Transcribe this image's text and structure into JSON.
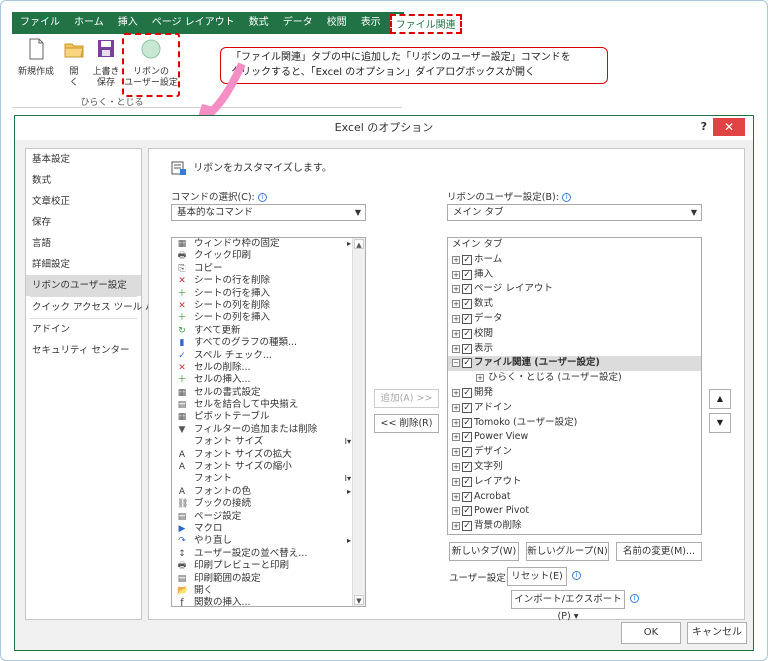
{
  "ribbon": {
    "tabs": [
      "ファイル",
      "ホーム",
      "挿入",
      "ページ レイアウト",
      "数式",
      "データ",
      "校閲",
      "表示"
    ],
    "active_tab": "ファイル関連",
    "buttons": [
      {
        "label": "新規作成"
      },
      {
        "label": "開\nく"
      },
      {
        "label": "上書き\n保存"
      },
      {
        "label": "リボンの\nユーザー設定"
      }
    ],
    "group_label": "ひらく・とじる"
  },
  "callout": {
    "line1": "「ファイル関連」タブの中に追加した「リボンのユーザー設定」コマンドを",
    "line2": "クリックすると、「Excel のオプション」ダイアログボックスが開く"
  },
  "dialog": {
    "title": "Excel のオプション",
    "help": "?",
    "close": "✕",
    "categories": [
      "基本設定",
      "数式",
      "文章校正",
      "保存",
      "言語",
      "詳細設定",
      "リボンのユーザー設定",
      "クイック アクセス ツール バー",
      "アドイン",
      "セキュリティ センター"
    ],
    "heading": "リボンをカスタマイズします。",
    "commands_label": "コマンドの選択(C):",
    "commands_combo": "基本的なコマンド",
    "ribbon_label": "リボンのユーザー設定(B):",
    "ribbon_combo": "メイン タブ",
    "commands": [
      {
        "label": "ウィンドウ枠の固定",
        "sub": "▸"
      },
      {
        "label": "クイック印刷"
      },
      {
        "label": "コピー"
      },
      {
        "label": "シートの行を削除"
      },
      {
        "label": "シートの行を挿入"
      },
      {
        "label": "シートの列を削除"
      },
      {
        "label": "シートの列を挿入"
      },
      {
        "label": "すべて更新"
      },
      {
        "label": "すべてのグラフの種類..."
      },
      {
        "label": "スペル チェック..."
      },
      {
        "label": "セルの削除..."
      },
      {
        "label": "セルの挿入..."
      },
      {
        "label": "セルの書式設定"
      },
      {
        "label": "セルを結合して中央揃え"
      },
      {
        "label": "ピボットテーブル"
      },
      {
        "label": "フィルターの追加または削除"
      },
      {
        "label": "フォント サイズ",
        "sub": "I▾"
      },
      {
        "label": "フォント サイズの拡大"
      },
      {
        "label": "フォント サイズの縮小"
      },
      {
        "label": "フォント",
        "sub": "I▾"
      },
      {
        "label": "フォントの色",
        "sub": "▸"
      },
      {
        "label": "ブックの接続"
      },
      {
        "label": "ページ設定"
      },
      {
        "label": "マクロ"
      },
      {
        "label": "やり直し",
        "sub": "▸"
      },
      {
        "label": "ユーザー設定の並べ替え..."
      },
      {
        "label": "印刷プレビューと印刷"
      },
      {
        "label": "印刷範囲の設定"
      },
      {
        "label": "開く"
      },
      {
        "label": "関数の挿入..."
      }
    ],
    "add_button": "追加(A) >>",
    "remove_button": "<< 削除(R)",
    "tree_header": "メイン タブ",
    "tree": [
      {
        "label": "ホーム"
      },
      {
        "label": "挿入"
      },
      {
        "label": "ページ レイアウト"
      },
      {
        "label": "数式"
      },
      {
        "label": "データ"
      },
      {
        "label": "校閲"
      },
      {
        "label": "表示"
      },
      {
        "label": "ファイル関連 (ユーザー設定)",
        "expanded": true
      },
      {
        "label": "ひらく・とじる (ユーザー設定)",
        "child": true
      },
      {
        "label": "開発"
      },
      {
        "label": "アドイン"
      },
      {
        "label": "Tomoko (ユーザー設定)"
      },
      {
        "label": "Power View"
      },
      {
        "label": "デザイン"
      },
      {
        "label": "文字列"
      },
      {
        "label": "レイアウト"
      },
      {
        "label": "Acrobat"
      },
      {
        "label": "Power Pivot"
      },
      {
        "label": "背景の削除"
      }
    ],
    "new_tab": "新しいタブ(W)",
    "new_group": "新しいグループ(N)",
    "rename": "名前の変更(M)...",
    "user_setting_label": "ユーザー設定:",
    "reset": "リセット(E) ▾",
    "import_export": "インポート/エクスポート(P) ▾",
    "up": "▲",
    "down": "▼",
    "ok": "OK",
    "cancel": "キャンセル"
  }
}
